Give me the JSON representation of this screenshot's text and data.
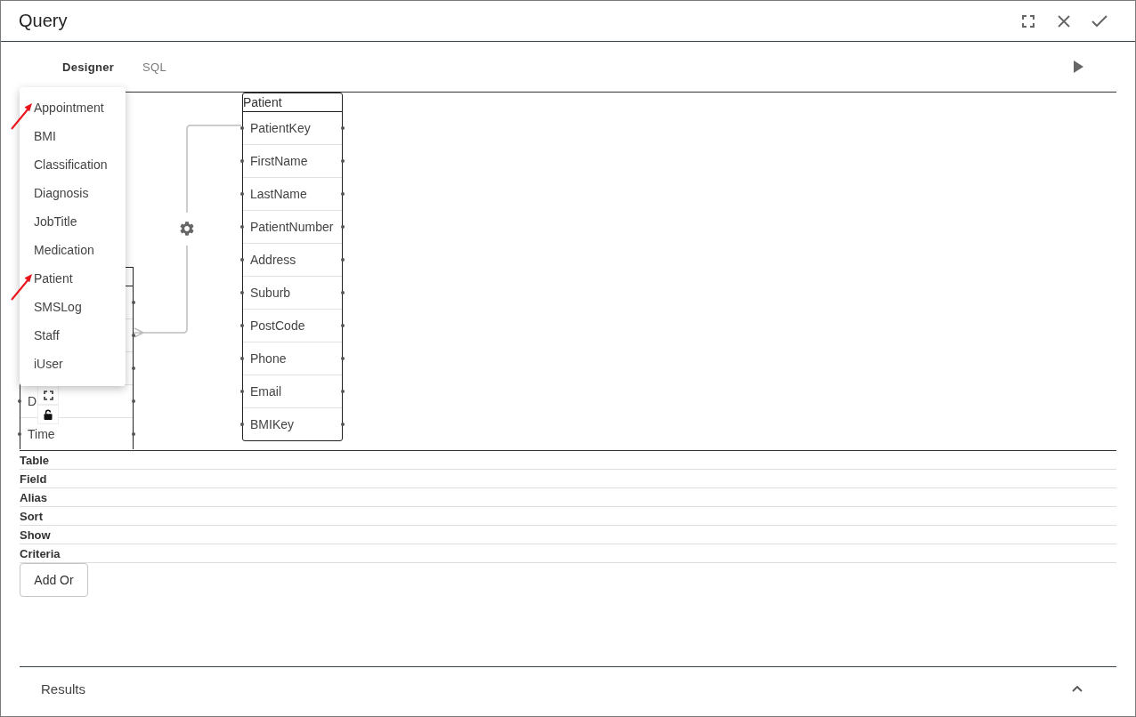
{
  "window": {
    "title": "Query"
  },
  "tabs": [
    {
      "label": "Designer",
      "selected": true
    },
    {
      "label": "SQL",
      "selected": false
    }
  ],
  "designer": {
    "covered_table": {
      "visible_fields": [
        "D",
        "Time"
      ]
    },
    "patient_table": {
      "title": "Patient",
      "fields": [
        "PatientKey",
        "FirstName",
        "LastName",
        "PatientNumber",
        "Address",
        "Suburb",
        "PostCode",
        "Phone",
        "Email",
        "BMIKey"
      ]
    },
    "table_menu": {
      "items": [
        {
          "label": "Appointment",
          "annotated": true
        },
        {
          "label": "BMI",
          "annotated": false
        },
        {
          "label": "Classification",
          "annotated": false
        },
        {
          "label": "Diagnosis",
          "annotated": false
        },
        {
          "label": "JobTitle",
          "annotated": false
        },
        {
          "label": "Medication",
          "annotated": false
        },
        {
          "label": "Patient",
          "annotated": true
        },
        {
          "label": "SMSLog",
          "annotated": false
        },
        {
          "label": "Staff",
          "annotated": false
        },
        {
          "label": "iUser",
          "annotated": false
        }
      ]
    }
  },
  "query_grid": {
    "row_labels": [
      "Table",
      "Field",
      "Alias",
      "Sort",
      "Show",
      "Criteria"
    ],
    "add_button": "Add Or"
  },
  "results_panel": {
    "title": "Results"
  }
}
